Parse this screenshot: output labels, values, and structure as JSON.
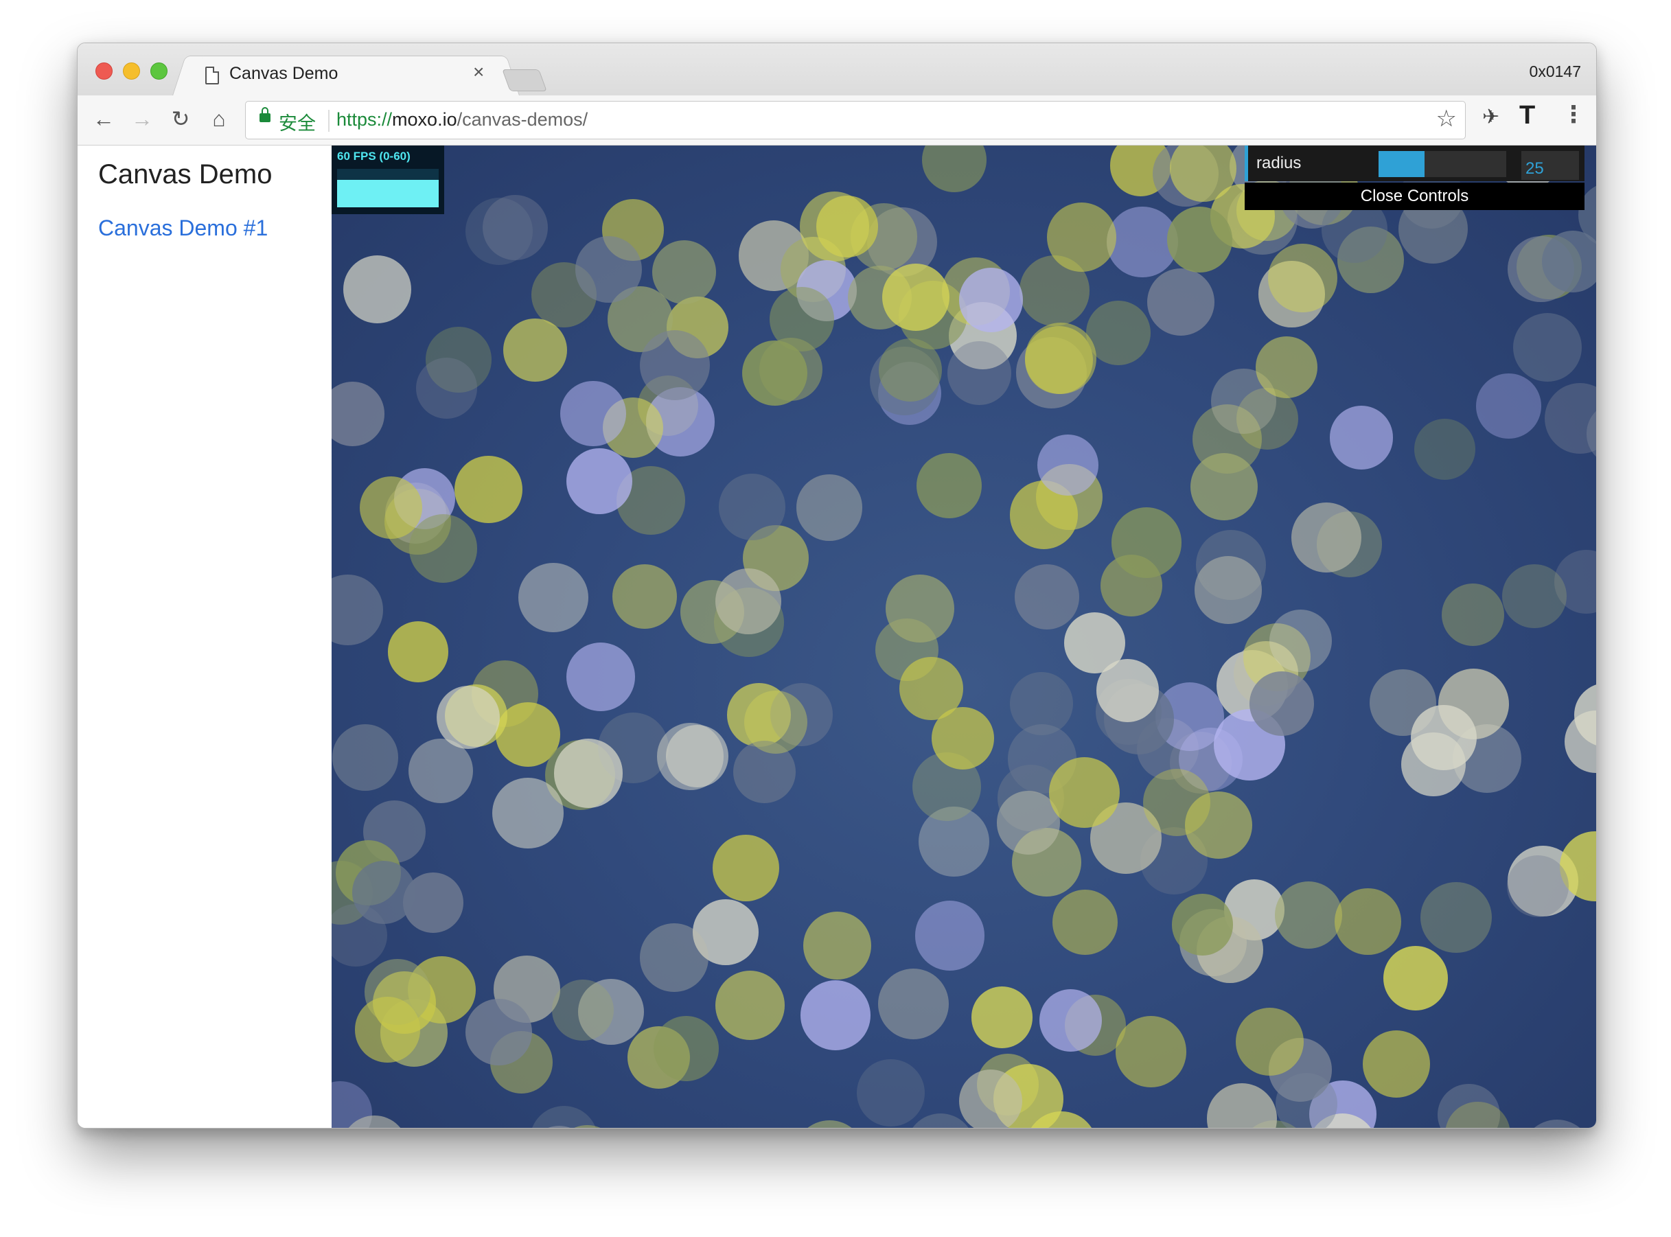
{
  "window": {
    "tab_title": "Canvas Demo",
    "tab_close": "×",
    "profile_label": "0x0147"
  },
  "toolbar": {
    "back_icon": "←",
    "forward_icon": "→",
    "reload_icon": "↻",
    "home_icon": "⌂",
    "secure_label": "安全",
    "url_scheme": "https://",
    "url_host": "moxo.io",
    "url_path": "/canvas-demos/",
    "star_icon": "☆",
    "extension_icon": "✈",
    "t_icon": "T",
    "menu_icon": "⋮"
  },
  "sidebar": {
    "title": "Canvas Demo",
    "link": "Canvas Demo #1"
  },
  "fps_meter": {
    "label": "60 FPS (0-60)",
    "fill_fraction": 0.72
  },
  "controls": {
    "param_label": "radius",
    "param_value": "25",
    "slider_fraction": 0.36,
    "close_label": "Close Controls"
  },
  "colors": {
    "stage_background": "#314a7c",
    "particle_yellow": "#c8c84a",
    "particle_lavender": "#b4b4f0",
    "particle_white": "#d8d8c8",
    "particle_olive": "#8a9a5a",
    "accent_blue": "#2fa1d6"
  }
}
